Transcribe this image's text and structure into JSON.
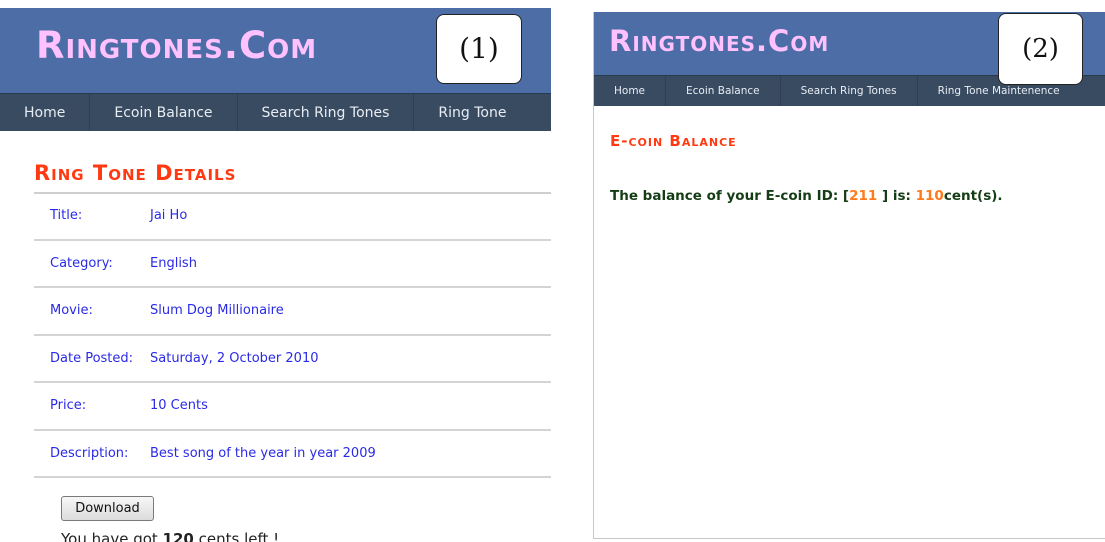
{
  "panel1": {
    "logo": "Ringtones.Com",
    "figure_label": "(1)",
    "nav": [
      "Home",
      "Ecoin Balance",
      "Search Ring Tones",
      "Ring Tone"
    ],
    "section_title": "Ring Tone Details",
    "details": [
      {
        "label": "Title:",
        "value": "Jai Ho"
      },
      {
        "label": "Category:",
        "value": "English"
      },
      {
        "label": "Movie:",
        "value": "Slum Dog Millionaire"
      },
      {
        "label": "Date Posted:",
        "value": "Saturday, 2 October 2010"
      },
      {
        "label": "Price:",
        "value": "10 Cents"
      },
      {
        "label": "Description:",
        "value": "Best song of the year in year 2009"
      }
    ],
    "download_label": "Download",
    "cents_prefix": "You have got ",
    "cents_value": "120",
    "cents_suffix": " cents left !"
  },
  "panel2": {
    "logo": "Ringtones.Com",
    "figure_label": "(2)",
    "nav": [
      "Home",
      "Ecoin Balance",
      "Search Ring Tones",
      "Ring Tone Maintenence"
    ],
    "section_title": "E-coin Balance",
    "balance_prefix": "The balance of your E-coin ID: [",
    "ecoin_id": "211",
    "balance_middle": " ] is: ",
    "balance_value": "110",
    "balance_unit": "cent(s)."
  },
  "colors": {
    "header_bg": "#4d6da6",
    "nav_bg": "#394b61",
    "logo": "#ffc1ff",
    "section_title": "#ff3a12",
    "detail_text": "#2a2ae6",
    "balance_text": "#153d15",
    "highlight": "#ff7a1a"
  }
}
